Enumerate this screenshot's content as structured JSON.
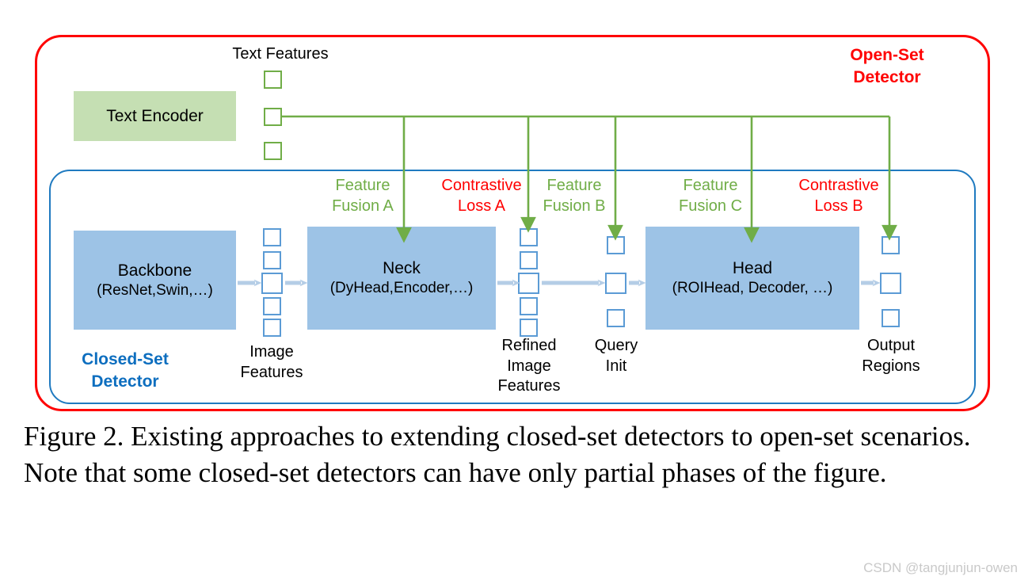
{
  "figure": {
    "caption": "Figure 2. Existing approaches to extending closed-set detectors to open-set scenarios.  Note that some closed-set detectors can have only partial phases of the figure.",
    "watermark": "CSDN @tangjunjun-owen"
  },
  "frames": {
    "open_set": {
      "label": "Open-Set\nDetector",
      "color": "#ff0000"
    },
    "closed_set": {
      "label": "Closed-Set\nDetector",
      "color": "#0d6ebf"
    }
  },
  "blocks": {
    "text_encoder": {
      "title": "Text Encoder",
      "fill": "#c5dfb3"
    },
    "backbone": {
      "title": "Backbone",
      "subtitle": "(ResNet,Swin,…)",
      "fill": "#9dc3e6"
    },
    "neck": {
      "title": "Neck",
      "subtitle": "(DyHead,Encoder,…)",
      "fill": "#9dc3e6"
    },
    "head": {
      "title": "Head",
      "subtitle": "(ROIHead, Decoder, …)",
      "fill": "#9dc3e6"
    }
  },
  "feature_columns": {
    "text_features": {
      "label": "Text Features",
      "count": 3,
      "stroke": "#70ad47"
    },
    "image_features": {
      "label": "Image\nFeatures",
      "count": 5,
      "stroke": "#5b9bd5"
    },
    "refined_image_features": {
      "label": "Refined\nImage\nFeatures",
      "count": 5,
      "stroke": "#5b9bd5"
    },
    "query_init": {
      "label": "Query\nInit",
      "count": 3,
      "stroke": "#5b9bd5"
    },
    "output_regions": {
      "label": "Output\nRegions",
      "count": 3,
      "stroke": "#5b9bd5"
    }
  },
  "flow_labels": [
    {
      "text": "Feature\nFusion A",
      "kind": "fusion",
      "color": "#70ad47"
    },
    {
      "text": "Contrastive\nLoss A",
      "kind": "loss",
      "color": "#ff0000"
    },
    {
      "text": "Feature\nFusion B",
      "kind": "fusion",
      "color": "#70ad47"
    },
    {
      "text": "Feature\nFusion C",
      "kind": "fusion",
      "color": "#70ad47"
    },
    {
      "text": "Contrastive\nLoss B",
      "kind": "loss",
      "color": "#ff0000"
    }
  ],
  "colors": {
    "green_line": "#70ad47",
    "blue_arrow": "#b4cde6",
    "blue_outline": "#5b9bd5",
    "red_frame": "#ff0000",
    "blue_frame": "#1f7ac0"
  }
}
